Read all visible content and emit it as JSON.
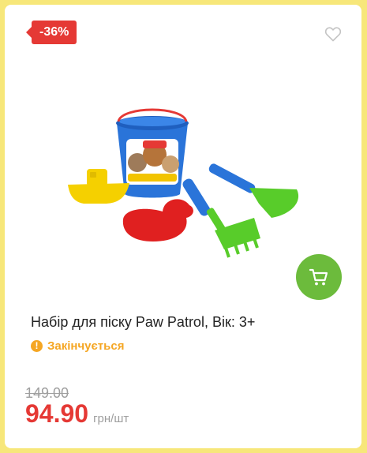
{
  "badge": {
    "discount": "-36%"
  },
  "product": {
    "title": "Набір для піску Paw Patrol, Вік: 3+",
    "status": "Закінчується",
    "old_price": "149.00",
    "price": "94.90",
    "unit": "грн/шт"
  },
  "colors": {
    "badge": "#e53935",
    "status": "#f5a623",
    "cart_button": "#6cbb3c",
    "price": "#e53935",
    "border": "#f7e77a"
  },
  "icons": {
    "favorite": "heart-icon",
    "cart": "cart-icon",
    "status": "warning-icon"
  }
}
